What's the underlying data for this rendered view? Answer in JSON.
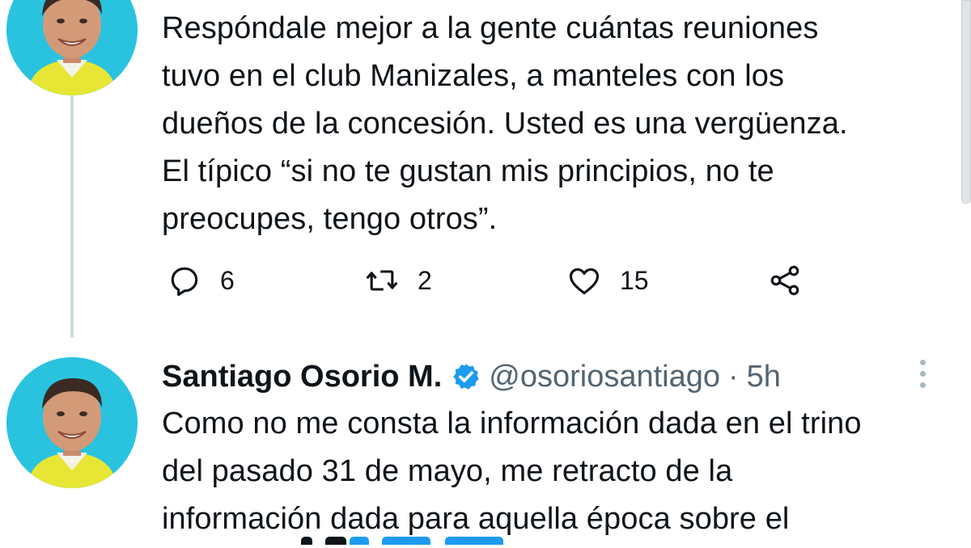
{
  "tweet_1": {
    "avatar_icon": "profile-photo",
    "text": "Respóndale mejor a la gente cuántas reuniones\ntuvo en el club Manizales, a manteles con los\ndueños de la concesión. Usted es una vergüenza.\nEl típico “si no te gustan mis principios, no te\npreocupes, tengo otros”.",
    "actions": {
      "reply_count": "6",
      "retweet_count": "2",
      "like_count": "15"
    }
  },
  "tweet_2": {
    "avatar_icon": "profile-photo",
    "author_name": "Santiago Osorio M.",
    "handle": "@osoriosantiago",
    "separator": "·",
    "time": "5h",
    "text": "Como no me consta la información dada en el trino\ndel pasado 31 de mayo, me retracto de la\ninformación dada para aquella época sobre el"
  },
  "colors": {
    "avatar_background": "#29c3e0",
    "verified": "#1d9bf0",
    "secondary_text": "#536471",
    "primary_text": "#0f1419",
    "thread_line": "#cfd9de"
  }
}
